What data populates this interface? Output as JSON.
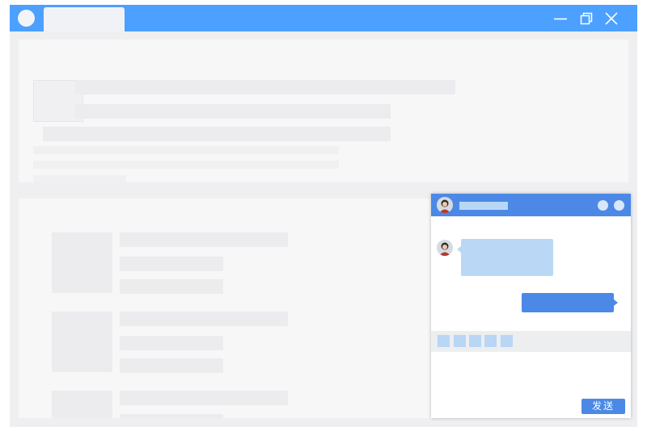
{
  "colors": {
    "titlebar": "#4ca0ff",
    "chat_header": "#4c89e6",
    "incoming_bubble": "#bad8f5",
    "outgoing_bubble": "#4c89e6",
    "page_background": "#efeff1"
  },
  "titlebar": {
    "icons": [
      "app-icon",
      "minimize-icon",
      "restore-icon",
      "close-icon"
    ]
  },
  "chat": {
    "icons": [
      "avatar",
      "header-dot",
      "header-dot"
    ],
    "send_label": "发送"
  }
}
